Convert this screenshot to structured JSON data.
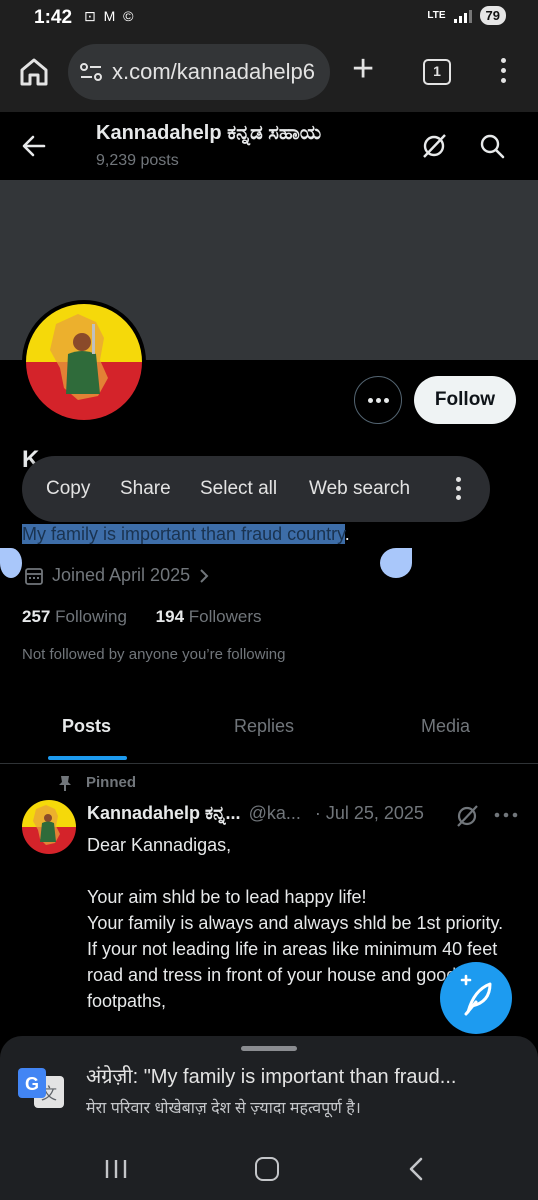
{
  "status_bar": {
    "time": "1:42",
    "notif_icons": "⊡ M ©",
    "network": "LTE",
    "battery": "79"
  },
  "browser": {
    "url": "x.com/kannadahelp6",
    "tab_count": "1"
  },
  "profile_header": {
    "name": "Kannadahelp ಕನ್ನಡ ಸಹಾಯ",
    "posts_count": "9,239 posts"
  },
  "profile": {
    "follow_label": "Follow",
    "name_partial": "K",
    "bio_selected": "My family is important than fraud country",
    "bio_rest": ".",
    "joined": "Joined April 2025",
    "following_count": "257",
    "following_label": "Following",
    "followers_count": "194",
    "followers_label": "Followers",
    "not_followed": "Not followed by anyone you’re following"
  },
  "selection_menu": {
    "copy": "Copy",
    "share": "Share",
    "select_all": "Select all",
    "web_search": "Web search"
  },
  "tabs": {
    "posts": "Posts",
    "replies": "Replies",
    "media": "Media"
  },
  "tweet": {
    "pinned_label": "Pinned",
    "name": "Kannadahelp ಕನ್ನ...",
    "handle": "@ka...",
    "date": "· Jul 25, 2025",
    "body": "Dear Kannadigas,\n\nYour aim shld be to lead happy life!\nYour family is always and always shld be 1st priority.\nIf your not leading life in areas like minimum 40 feet road and tress in front of your house and good footpaths,"
  },
  "translate_bar": {
    "line1": "अंग्रेज़ी: \"My family is important than fraud...",
    "line2": "मेरा परिवार धोखेबाज़ देश से ज़्यादा महत्वपूर्ण है।"
  },
  "colors": {
    "accent": "#1d9bf0",
    "background": "#000000",
    "selection_highlight": "#3d6da8",
    "flag_yellow": "#f5d90a",
    "flag_red": "#d4232a"
  }
}
